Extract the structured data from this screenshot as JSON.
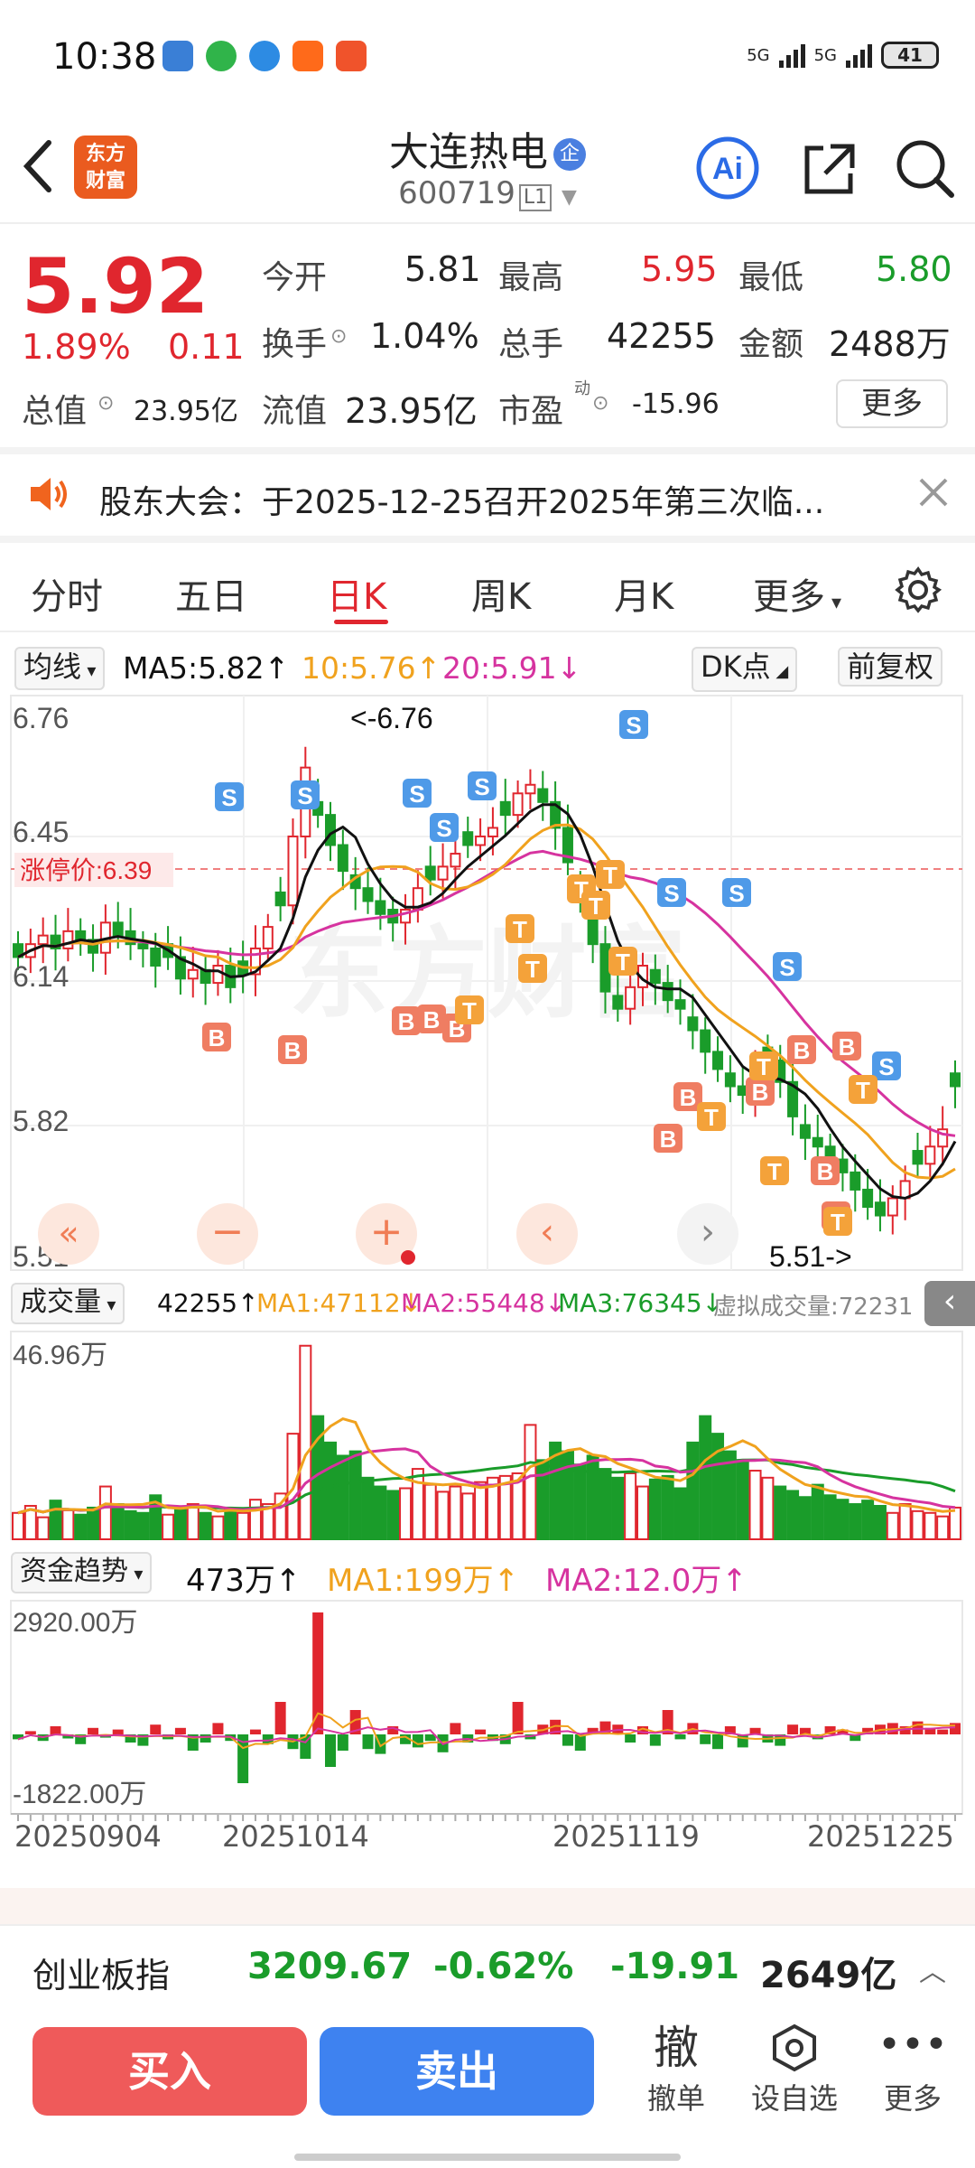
{
  "status_bar": {
    "time": "10:38",
    "signal1": "5G",
    "signal2": "5G",
    "battery": "41"
  },
  "header": {
    "name": "大连热电",
    "badge": "企",
    "code": "600719",
    "level": "L1",
    "logo_line1": "东方",
    "logo_line2": "财富",
    "ai_label": "Ai"
  },
  "quote": {
    "price": "5.92",
    "pct": "1.89%",
    "change": "0.11",
    "open_label": "今开",
    "open": "5.81",
    "high_label": "最高",
    "high": "5.95",
    "low_label": "最低",
    "low": "5.80",
    "turnover_label": "换手",
    "turnover": "1.04%",
    "volume_label": "总手",
    "volume": "42255",
    "amount_label": "金额",
    "amount": "2488万",
    "mcap_label": "总值",
    "mcap": "23.95亿",
    "float_label": "流值",
    "float": "23.95亿",
    "pe_label": "市盈",
    "pe_sup": "动",
    "pe": "-15.96",
    "more": "更多"
  },
  "notice": {
    "text": "股东大会：于2025-12-25召开2025年第三次临..."
  },
  "tabs": [
    {
      "label": "分时"
    },
    {
      "label": "五日"
    },
    {
      "label": "日K"
    },
    {
      "label": "周K"
    },
    {
      "label": "月K"
    },
    {
      "label": "更多"
    }
  ],
  "ma": {
    "selector": "均线",
    "ma5": "MA5:5.82",
    "ma10": "10:5.76",
    "ma20": "20:5.91",
    "dk": "DK点",
    "fq": "前复权"
  },
  "kline": {
    "ticks": [
      "6.76",
      "6.45",
      "6.14",
      "5.82",
      "5.51"
    ],
    "limit_label": "涨停价:6.39",
    "max_label": "<-6.76",
    "min_label": "5.51->",
    "watermark": "东方财富"
  },
  "volume": {
    "selector": "成交量",
    "current": "42255",
    "ma1": "MA1:47112",
    "ma2": "MA2:55448",
    "ma3": "MA3:76345",
    "virtual": "虚拟成交量:72231",
    "top": "46.96万"
  },
  "fund": {
    "selector": "资金趋势",
    "current": "473万",
    "ma1": "MA1:199万",
    "ma2": "MA2:12.0万",
    "top": "2920.00万",
    "bottom": "-1822.00万"
  },
  "dates": [
    "20250904",
    "20251014",
    "20251119",
    "20251225"
  ],
  "index_bar": {
    "name": "创业板指",
    "value": "3209.67",
    "pct": "-0.62%",
    "change": "-19.91",
    "amount": "2649亿"
  },
  "actions": {
    "buy": "买入",
    "sell": "卖出",
    "cancel_icon": "撤",
    "cancel": "撤单",
    "watch": "设自选",
    "more": "更多"
  },
  "colors": {
    "up": "#e0262e",
    "down": "#1a9c2a",
    "ma5": "#111111",
    "ma10": "#f0a21e",
    "ma20": "#d6339f",
    "sell_marker": "#4f9ae8",
    "buy_marker": "#ef7d62",
    "t_marker": "#f4a23a"
  }
}
